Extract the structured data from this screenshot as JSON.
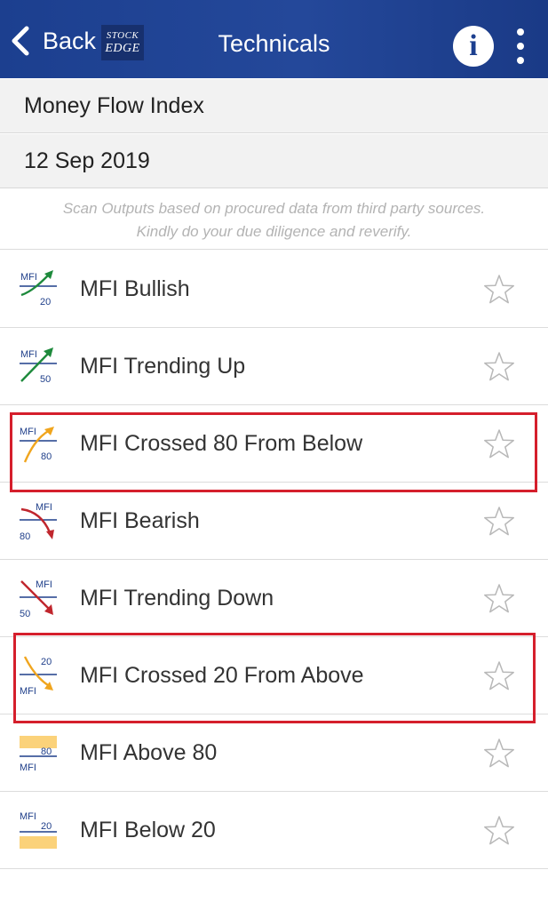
{
  "header": {
    "back_label": "Back",
    "logo_line1": "STOCK",
    "logo_line2": "EDGE",
    "title": "Technicals",
    "info_glyph": "i",
    "icons": [
      "chevron-left-icon",
      "info-icon",
      "more-vertical-icon"
    ]
  },
  "subheader": {
    "indicator": "Money Flow Index",
    "date": "12 Sep 2019"
  },
  "disclaimer": {
    "line1": "Scan Outputs based on procured data from third party sources.",
    "line2": "Kindly do your due diligence and reverify."
  },
  "scans": [
    {
      "label": "MFI Bullish",
      "icon_top": "MFI",
      "icon_bottom": "20",
      "icon": "bullish-arrow-icon",
      "highlighted": false
    },
    {
      "label": "MFI Trending Up",
      "icon_top": "MFI",
      "icon_bottom": "50",
      "icon": "trending-up-arrow-icon",
      "highlighted": false
    },
    {
      "label": "MFI Crossed 80 From Below",
      "icon_top": "MFI",
      "icon_bottom": "80",
      "icon": "cross-above-arrow-icon",
      "highlighted": true
    },
    {
      "label": "MFI Bearish",
      "icon_top": "MFI",
      "icon_bottom": "80",
      "icon": "bearish-arrow-icon",
      "highlighted": false
    },
    {
      "label": "MFI Trending Down",
      "icon_top": "MFI",
      "icon_bottom": "50",
      "icon": "trending-down-arrow-icon",
      "highlighted": false
    },
    {
      "label": "MFI Crossed 20 From Above",
      "icon_top": "20",
      "icon_bottom": "MFI",
      "icon": "cross-below-arrow-icon",
      "highlighted": true
    },
    {
      "label": "MFI Above 80",
      "icon_top": "80",
      "icon_bottom": "MFI",
      "icon": "above-band-icon",
      "highlighted": false
    },
    {
      "label": "MFI Below 20",
      "icon_top": "MFI",
      "icon_bottom": "20",
      "icon": "below-band-icon",
      "highlighted": false
    }
  ],
  "colors": {
    "nav_bar": "#1c3f8f",
    "bullish_green": "#1e8a3c",
    "bearish_red": "#c0262d",
    "cross_orange": "#f0a51e",
    "band_yellow": "#fbd27a",
    "icon_text_blue": "#1f3f8a",
    "highlight_red": "#d51f2c"
  }
}
